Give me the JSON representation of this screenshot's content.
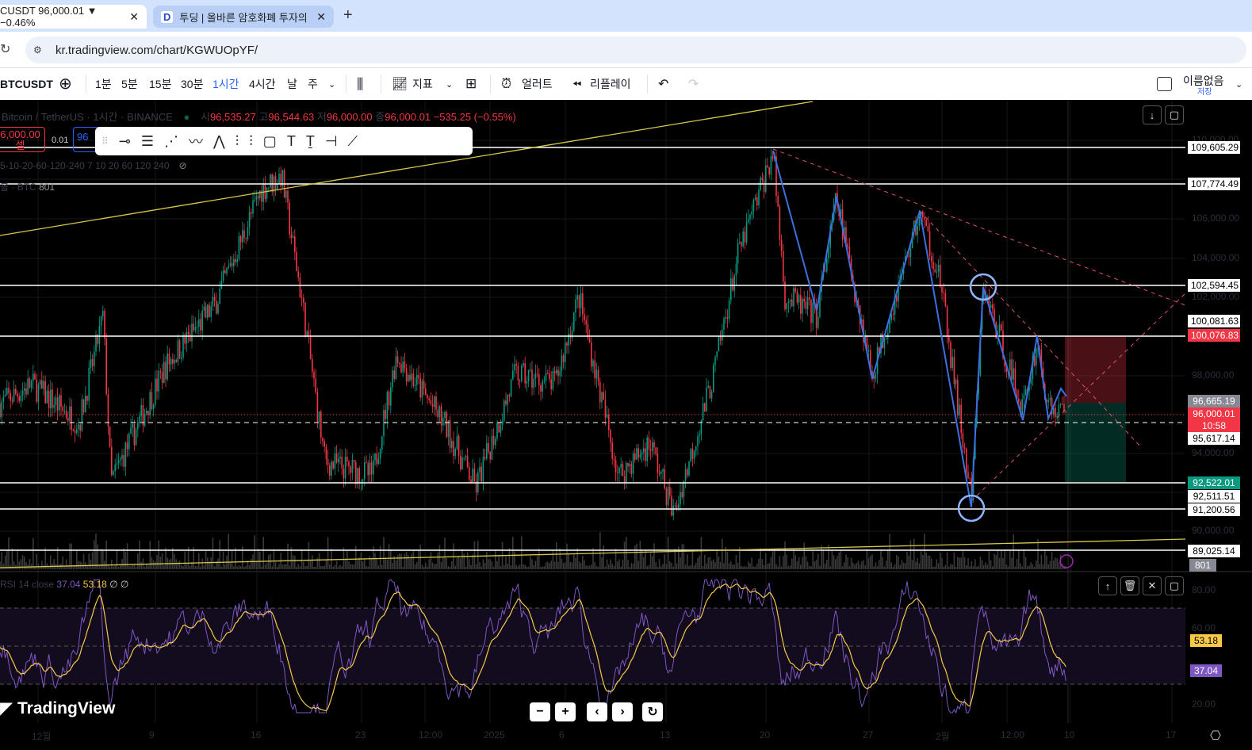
{
  "browser": {
    "tabs": [
      {
        "label": "CUSDT 96,000.01 ▼ −0.46%"
      },
      {
        "label": "투딩 | 올바른 암호화폐 투자의"
      }
    ],
    "new_tab": "+",
    "close": "✕",
    "url": "kr.tradingview.com/chart/KGWUOpYF/"
  },
  "toolbar": {
    "symbol": "BTCUSDT",
    "intervals": [
      "1분",
      "5분",
      "15분",
      "30분",
      "1시간",
      "4시간",
      "날",
      "주"
    ],
    "active_interval": "1시간",
    "indicators": "지표",
    "alert": "얼러트",
    "replay": "리플레이",
    "layout_name": "이름없음",
    "save": "저장"
  },
  "legend": {
    "title": "Bitcoin / TetherUS · 1시간 · BINANCE",
    "o_label": "시",
    "o": "96,535.27",
    "h_label": "고",
    "h": "96,544.63",
    "l_label": "저",
    "l": "96,000.00",
    "c_label": "종",
    "c": "96,000.01",
    "change": "−535.25 (−0.55%)",
    "sell_price": "6,000.00",
    "sell_label": "셀",
    "spread": "0.01",
    "buy_price": "96",
    "ma_line": "5-10-20-60-120-240 7 10 20 60 120 240",
    "vol_label": "볼 · BTC",
    "vol_value": "801"
  },
  "price_axis": {
    "ticks": [
      "110,000.00",
      "106,000.00",
      "104,000.00",
      "102,000.00",
      "98,000.00",
      "94,000.00",
      "90,000.00"
    ],
    "labels": [
      {
        "v": "109,605.29",
        "t": "w"
      },
      {
        "v": "107,774.49",
        "t": "w"
      },
      {
        "v": "102,594.45",
        "t": "w"
      },
      {
        "v": "100,081.63",
        "t": "w"
      },
      {
        "v": "100,076.83",
        "t": "r"
      },
      {
        "v": "96,665.19",
        "t": "g"
      },
      {
        "v": "96,000.01",
        "t": "r"
      },
      {
        "v": "95,617.14",
        "t": "w"
      },
      {
        "v": "92,522.01",
        "t": "t"
      },
      {
        "v": "92,511.51",
        "t": "w"
      },
      {
        "v": "91,200.56",
        "t": "w"
      },
      {
        "v": "89,025.14",
        "t": "w"
      },
      {
        "v": "801",
        "t": "g"
      }
    ],
    "countdown": "10:58"
  },
  "rsi": {
    "legend": "RSI 14 close",
    "rsi": "37.04",
    "ma": "53.18",
    "na": "∅ ∅",
    "ticks": [
      "80.00",
      "60.00",
      "20.00"
    ],
    "rsi_label": "37.04",
    "ma_label": "53.18"
  },
  "time_axis": [
    "12월",
    "9",
    "16",
    "23",
    "12:00",
    "2025",
    "6",
    "13",
    "20",
    "27",
    "2월",
    "12:00",
    "10",
    "17"
  ],
  "brand": "TradingView",
  "colors": {
    "up": "#089981",
    "down": "#f23645",
    "zigzag": "#3d6fe0",
    "rsi": "#7e57c2",
    "rsi_ma": "#f7c948"
  }
}
